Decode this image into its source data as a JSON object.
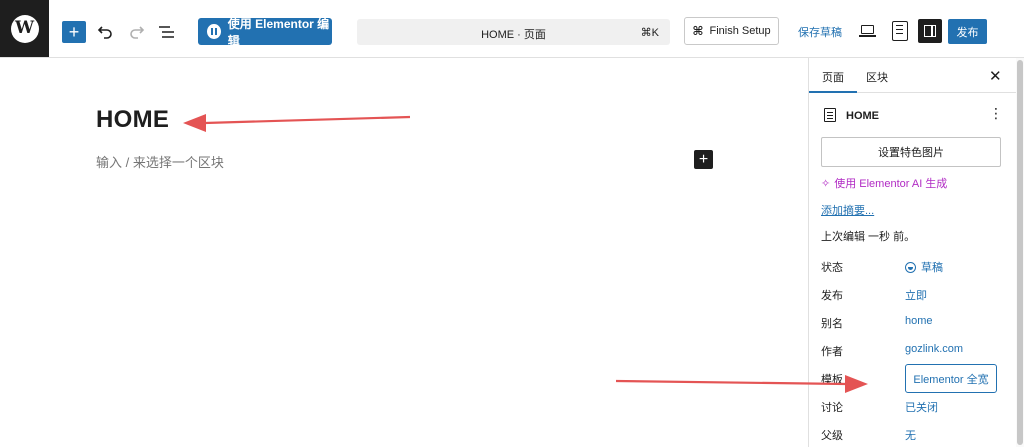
{
  "toolbar": {
    "logo_icon": "wordpress-logo",
    "logo_glyph": "W",
    "add_icon": "plus-icon",
    "add_glyph": "+",
    "undo_icon": "undo-icon",
    "redo_icon": "redo-icon",
    "list_view_icon": "list-view-icon",
    "elementor_label": "使用 Elementor 编辑",
    "doc_title": "HOME · 页面",
    "doc_shortcut": "⌘K",
    "finish_setup_label": "Finish Setup",
    "finish_setup_glyph": "⌘",
    "save_draft_label": "保存草稿",
    "view_icon": "desktop-view-icon",
    "document_icon": "document-icon",
    "settings_icon": "sidebar-toggle-icon",
    "publish_label": "发布",
    "accent_color": "#2271b1"
  },
  "canvas": {
    "heading": "HOME",
    "placeholder": "输入 / 来选择一个区块",
    "inserter_glyph": "+"
  },
  "sidebar": {
    "tabs": [
      {
        "label": "页面",
        "active": true
      },
      {
        "label": "区块",
        "active": false
      }
    ],
    "close_glyph": "✕",
    "doc_title": "HOME",
    "more_glyph": "⋮",
    "featured_image_label": "设置特色图片",
    "ai_sparkle": "✧",
    "ai_link_label": "使用 Elementor AI 生成",
    "excerpt_link_label": "添加摘要...",
    "last_edited": "上次编辑 一秒 前。",
    "meta": [
      {
        "label": "状态",
        "value": "草稿"
      },
      {
        "label": "发布",
        "value": "立即"
      },
      {
        "label": "别名",
        "value": "home"
      },
      {
        "label": "作者",
        "value": "gozlink.com"
      },
      {
        "label": "模板",
        "value": "Elementor 全宽"
      },
      {
        "label": "讨论",
        "value": "已关闭"
      },
      {
        "label": "父级",
        "value": "无"
      }
    ]
  },
  "annotations": {
    "arrow_color": "#e45454"
  }
}
